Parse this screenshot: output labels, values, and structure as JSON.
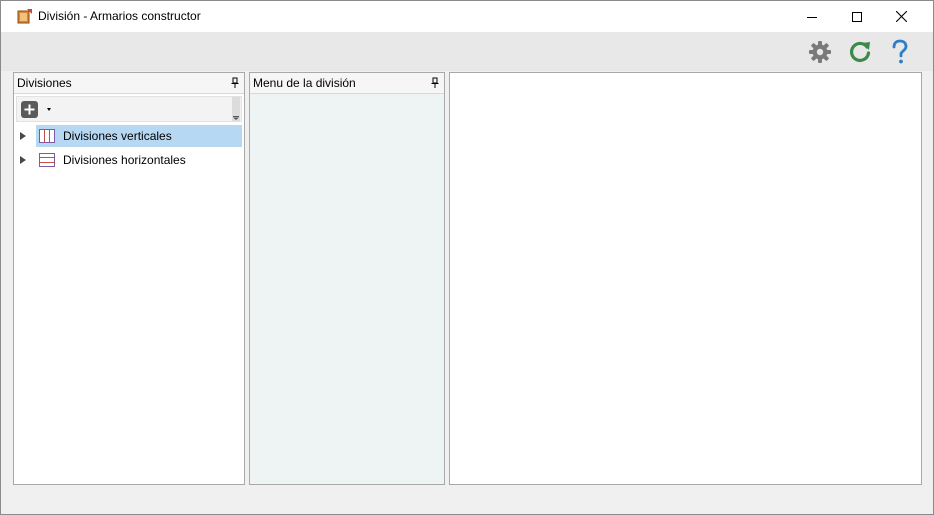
{
  "window": {
    "title": "División - Armarios constructor",
    "app_icon": "app-icon",
    "controls": {
      "minimize": "minimize-icon",
      "maximize": "maximize-icon",
      "close": "close-icon"
    }
  },
  "toolbar": {
    "buttons": [
      {
        "name": "settings",
        "icon": "gear-icon",
        "color": "#7a7a7a"
      },
      {
        "name": "refresh",
        "icon": "refresh-icon",
        "color": "#3c8a4a"
      },
      {
        "name": "help",
        "icon": "help-icon",
        "color": "#2c7fc4"
      }
    ]
  },
  "panels": {
    "divisiones": {
      "title": "Divisiones",
      "pin_icon": "pin-icon",
      "toolbar": {
        "add_icon": "plus-square-icon",
        "dropdown_icon": "chevron-down-icon"
      },
      "tree": [
        {
          "label": "Divisiones verticales",
          "icon": "vertical-divisions-icon",
          "selected": true
        },
        {
          "label": "Divisiones horizontales",
          "icon": "horizontal-divisions-icon",
          "selected": false
        }
      ]
    },
    "menu": {
      "title": "Menu de la división",
      "pin_icon": "pin-icon"
    },
    "preview": {}
  },
  "colors": {
    "selection": "#b7d8f3",
    "menu_panel_bg": "#eef3f3",
    "division_line_color": "#c0504d"
  }
}
